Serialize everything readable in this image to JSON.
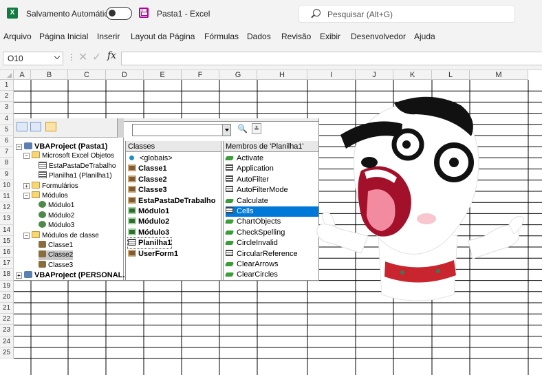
{
  "titlebar": {
    "app_logo": "X",
    "autosave_label": "Salvamento Automático",
    "doc_title": "Pasta1  -  Excel",
    "search_placeholder": "Pesquisar (Alt+G)"
  },
  "ribbon": {
    "tabs": [
      "Arquivo",
      "Página Inicial",
      "Inserir",
      "Layout da Página",
      "Fórmulas",
      "Dados",
      "Revisão",
      "Exibir",
      "Desenvolvedor",
      "Ajuda"
    ]
  },
  "formula_bar": {
    "name_box": "O10",
    "fx": "fx",
    "formula": ""
  },
  "grid": {
    "columns": [
      "A",
      "B",
      "C",
      "D",
      "E",
      "F",
      "G",
      "H",
      "I",
      "J",
      "K",
      "L",
      "M"
    ],
    "rows": [
      "1",
      "2",
      "3",
      "4",
      "5",
      "6",
      "7",
      "8",
      "9",
      "10",
      "11",
      "12",
      "13",
      "14",
      "15",
      "16",
      "17",
      "18",
      "19",
      "20",
      "21",
      "22",
      "23",
      "24",
      "25"
    ]
  },
  "vba": {
    "tree": [
      {
        "label": "VBAProject (Pasta1)",
        "bold": true,
        "indent": 0,
        "icon": "proj",
        "expander": "−"
      },
      {
        "label": "Microsoft Excel Objetos",
        "bold": false,
        "indent": 1,
        "icon": "folder",
        "expander": "−"
      },
      {
        "label": "EstaPastaDeTrabalho",
        "bold": false,
        "indent": 3,
        "icon": "sheet"
      },
      {
        "label": "Planilha1 (Planilha1)",
        "bold": false,
        "indent": 3,
        "icon": "sheet"
      },
      {
        "label": "Formulários",
        "bold": false,
        "indent": 1,
        "icon": "folder",
        "expander": "+"
      },
      {
        "label": "Módulos",
        "bold": false,
        "indent": 1,
        "icon": "folder",
        "expander": "−"
      },
      {
        "label": "Módulo1",
        "bold": false,
        "indent": 3,
        "icon": "mod"
      },
      {
        "label": "Módulo2",
        "bold": false,
        "indent": 3,
        "icon": "mod"
      },
      {
        "label": "Módulo3",
        "bold": false,
        "indent": 3,
        "icon": "mod"
      },
      {
        "label": "Módulos de classe",
        "bold": false,
        "indent": 1,
        "icon": "folder",
        "expander": "−"
      },
      {
        "label": "Classe1",
        "bold": false,
        "indent": 3,
        "icon": "cls"
      },
      {
        "label": "Classe2",
        "bold": false,
        "indent": 3,
        "icon": "cls",
        "selected": true
      },
      {
        "label": "Classe3",
        "bold": false,
        "indent": 3,
        "icon": "cls"
      },
      {
        "label": "VBAProject (PERSONAL.X",
        "bold": true,
        "indent": 0,
        "icon": "proj",
        "expander": "+"
      }
    ],
    "classes_header": "Classes",
    "classes": [
      {
        "label": "<globais>",
        "bold": false,
        "icon": "global"
      },
      {
        "label": "Classe1",
        "bold": true,
        "icon": "cls"
      },
      {
        "label": "Classe2",
        "bold": true,
        "icon": "cls"
      },
      {
        "label": "Classe3",
        "bold": true,
        "icon": "cls"
      },
      {
        "label": "EstaPastaDeTrabalho",
        "bold": true,
        "icon": "cls"
      },
      {
        "label": "Módulo1",
        "bold": true,
        "icon": "mod"
      },
      {
        "label": "Módulo2",
        "bold": true,
        "icon": "mod"
      },
      {
        "label": "Módulo3",
        "bold": true,
        "icon": "mod"
      },
      {
        "label": "Planilha1",
        "bold": true,
        "icon": "sheet",
        "boxed": true
      },
      {
        "label": "UserForm1",
        "bold": true,
        "icon": "cls"
      }
    ],
    "members_header": "Membros de 'Planilha1'",
    "members": [
      {
        "label": "Activate",
        "icon": "method"
      },
      {
        "label": "Application",
        "icon": "prop"
      },
      {
        "label": "AutoFilter",
        "icon": "prop"
      },
      {
        "label": "AutoFilterMode",
        "icon": "prop"
      },
      {
        "label": "Calculate",
        "icon": "method"
      },
      {
        "label": "Cells",
        "icon": "prop",
        "selected": true
      },
      {
        "label": "ChartObjects",
        "icon": "method"
      },
      {
        "label": "CheckSpelling",
        "icon": "method"
      },
      {
        "label": "CircleInvalid",
        "icon": "method"
      },
      {
        "label": "CircularReference",
        "icon": "prop"
      },
      {
        "label": "ClearArrows",
        "icon": "method"
      },
      {
        "label": "ClearCircles",
        "icon": "method"
      }
    ]
  },
  "colors": {
    "excel_green": "#107c41",
    "selection_blue": "#0078d7",
    "save_magenta": "#b4009e"
  }
}
